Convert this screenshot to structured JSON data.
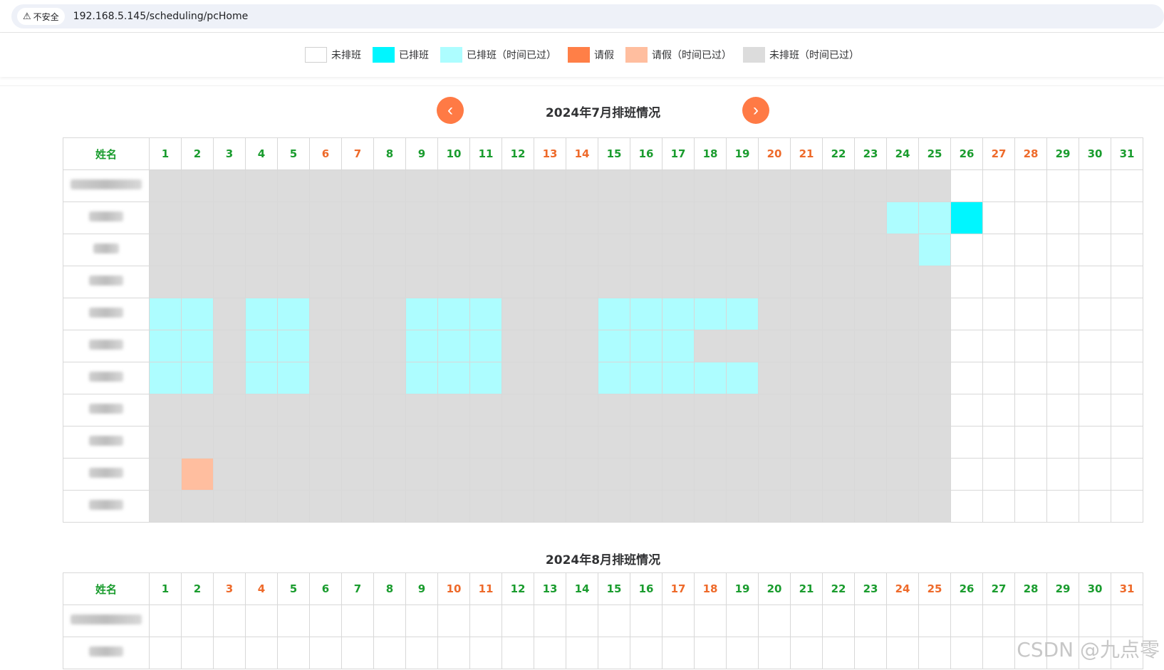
{
  "browser": {
    "security_label": "不安全",
    "url": "192.168.5.145/scheduling/pcHome"
  },
  "legend": [
    {
      "label": "未排班",
      "color": "#ffffff"
    },
    {
      "label": "已排班",
      "color": "#00f6ff"
    },
    {
      "label": "已排班（时间已过）",
      "color": "#adfdff"
    },
    {
      "label": "请假",
      "color": "#ff7f47"
    },
    {
      "label": "请假（时间已过）",
      "color": "#ffbe9f"
    },
    {
      "label": "未排班（时间已过）",
      "color": "#dcdcdc"
    }
  ],
  "nav": {
    "prev_icon": "chevron-left-icon",
    "next_icon": "chevron-right-icon"
  },
  "name_header": "姓名",
  "months": [
    {
      "title": "2024年7月排班情况",
      "days": [
        1,
        2,
        3,
        4,
        5,
        6,
        7,
        8,
        9,
        10,
        11,
        12,
        13,
        14,
        15,
        16,
        17,
        18,
        19,
        20,
        21,
        22,
        23,
        24,
        25,
        26,
        27,
        28,
        29,
        30,
        31
      ],
      "weekend_days": [
        6,
        7,
        13,
        14,
        20,
        21,
        27,
        28
      ],
      "rows": [
        "5555555555555555555555555000000",
        "5555555555555555555555522100000",
        "5555555555555555555555552000000",
        "5555555555555555555555555000000",
        "2252255522255522222555555000000",
        "2252255522255522255555555000000",
        "2252255522255522222555555000000",
        "5555555555555555555555555000000",
        "5555555555555555555555555000000",
        "5455555555555555555555555000000",
        "5555555555555555555555555000000"
      ]
    },
    {
      "title": "2024年8月排班情况",
      "days": [
        1,
        2,
        3,
        4,
        5,
        6,
        7,
        8,
        9,
        10,
        11,
        12,
        13,
        14,
        15,
        16,
        17,
        18,
        19,
        20,
        21,
        22,
        23,
        24,
        25,
        26,
        27,
        28,
        29,
        30,
        31
      ],
      "weekend_days": [
        3,
        4,
        10,
        11,
        17,
        18,
        24,
        25,
        31
      ],
      "rows": [
        "0000000000000000000000000000000",
        "0000000000000000000000000000000"
      ]
    }
  ],
  "watermark": "CSDN @九点零"
}
